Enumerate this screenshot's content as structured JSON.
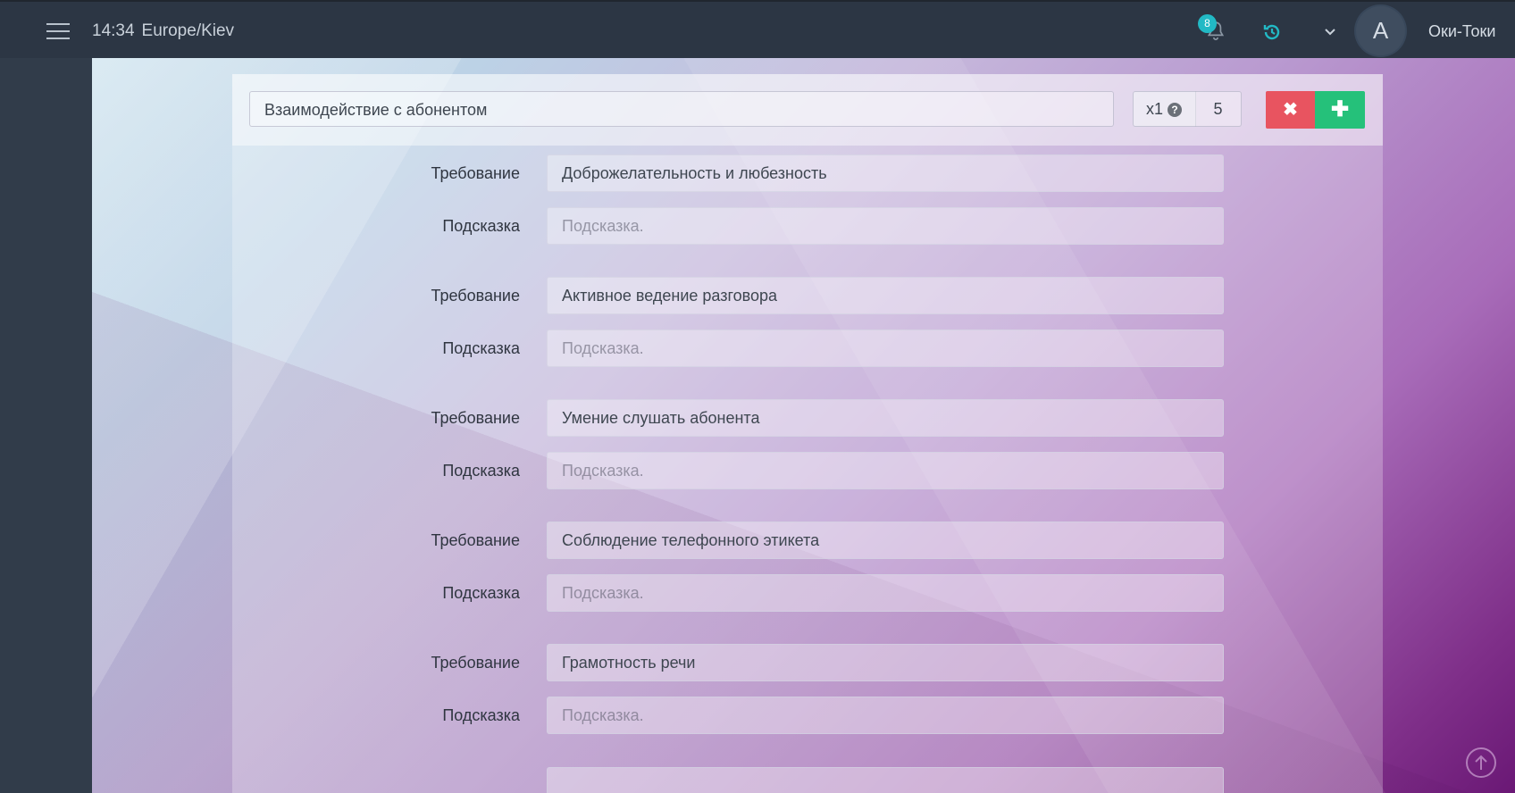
{
  "header": {
    "time": "14:34",
    "timezone": "Europe/Kiev",
    "notifications_count": "8",
    "avatar_letter": "A",
    "username": "Оки-Токи"
  },
  "section": {
    "title": "Взаимодействие с абонентом",
    "multiplier_label": "x1",
    "help_glyph": "?",
    "weight": "5",
    "delete_glyph": "✖",
    "add_glyph": "✚"
  },
  "requirements": [
    {
      "req_label": "Требование",
      "req_value": "Доброжелательность и любезность",
      "hint_label": "Подсказка",
      "hint_placeholder": "Подсказка."
    },
    {
      "req_label": "Требование",
      "req_value": "Активное ведение разговора",
      "hint_label": "Подсказка",
      "hint_placeholder": "Подсказка."
    },
    {
      "req_label": "Требование",
      "req_value": "Умение слушать абонента",
      "hint_label": "Подсказка",
      "hint_placeholder": "Подсказка."
    },
    {
      "req_label": "Требование",
      "req_value": "Соблюдение телефонного этикета",
      "hint_label": "Подсказка",
      "hint_placeholder": "Подсказка."
    },
    {
      "req_label": "Требование",
      "req_value": "Грамотность речи",
      "hint_label": "Подсказка",
      "hint_placeholder": "Подсказка."
    }
  ],
  "icons": {
    "menu": "hamburger-icon",
    "notifications": "bell-icon",
    "history": "history-icon",
    "dropdown": "chevron-down-icon",
    "scroll_top": "arrow-up-circle-icon"
  },
  "colors": {
    "topbar": "#2c3644",
    "badge": "#22b9c5",
    "history_icon": "#22b9c5",
    "delete_button": "#e85460",
    "add_button": "#25c17a"
  }
}
